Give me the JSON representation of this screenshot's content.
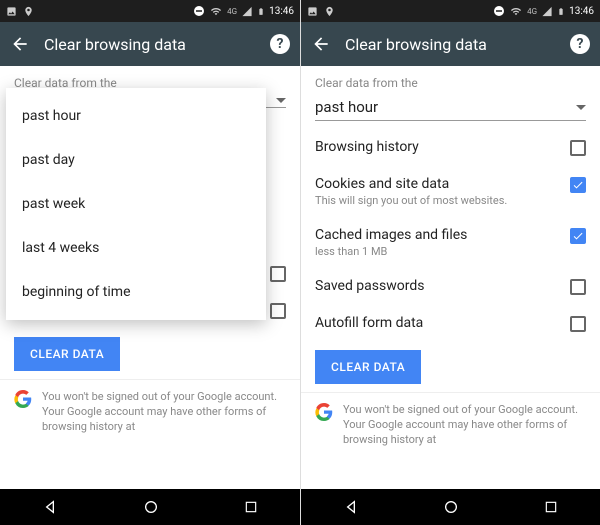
{
  "status": {
    "time": "13:46",
    "network": "4G"
  },
  "appbar": {
    "title": "Clear browsing data"
  },
  "section_label": "Clear data from the",
  "dropdown": {
    "selected": "past hour",
    "options": [
      "past hour",
      "past day",
      "past week",
      "last 4 weeks",
      "beginning of time"
    ]
  },
  "items": [
    {
      "label": "Browsing history",
      "sub": "",
      "checked": false
    },
    {
      "label": "Cookies and site data",
      "sub": "This will sign you out of most websites.",
      "checked": true
    },
    {
      "label": "Cached images and files",
      "sub": "less than 1 MB",
      "checked": true
    },
    {
      "label": "Saved passwords",
      "sub": "",
      "checked": false
    },
    {
      "label": "Autofill form data",
      "sub": "",
      "checked": false
    }
  ],
  "action": "CLEAR DATA",
  "footer": "You won't be signed out of your Google account. Your Google account may have other forms of browsing history at"
}
